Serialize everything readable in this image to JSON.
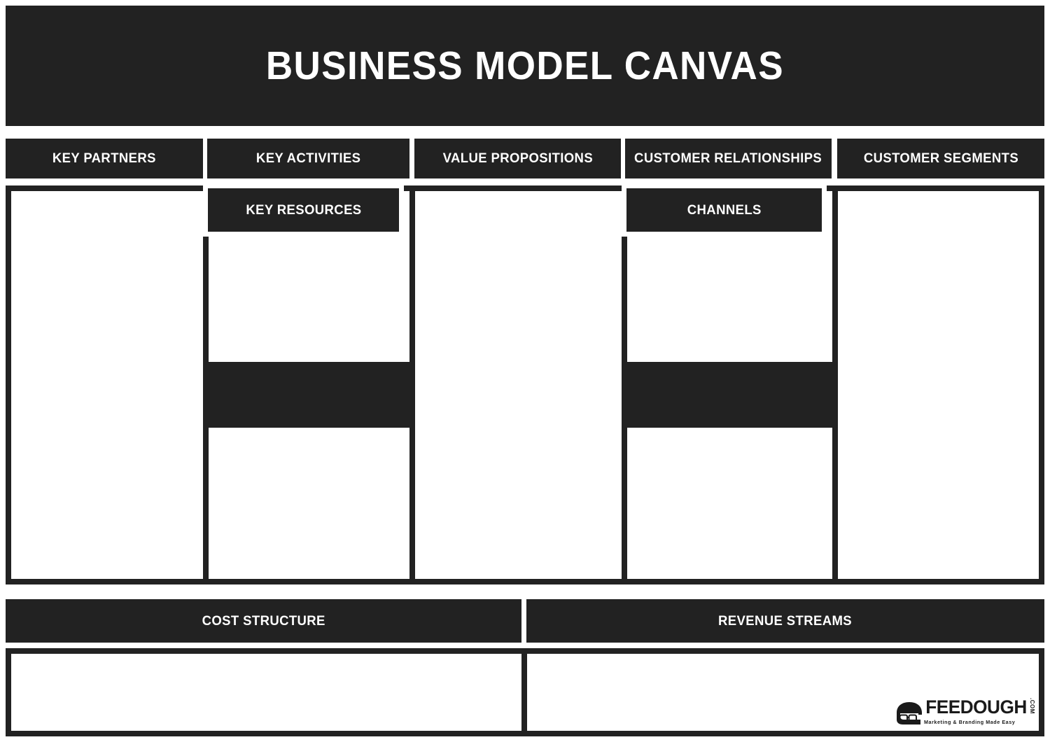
{
  "title": "BUSINESS MODEL CANVAS",
  "columns": [
    {
      "id": "key-partners",
      "label": "KEY PARTNERS"
    },
    {
      "id": "key-activities",
      "label": "KEY ACTIVITIES"
    },
    {
      "id": "value-propositions",
      "label": "VALUE PROPOSITIONS"
    },
    {
      "id": "customer-relationships",
      "label": "CUSTOMER RELATIONSHIPS"
    },
    {
      "id": "customer-segments",
      "label": "CUSTOMER SEGMENTS"
    }
  ],
  "sub_sections": [
    {
      "id": "key-resources",
      "label": "KEY RESOURCES"
    },
    {
      "id": "channels",
      "label": "CHANNELS"
    }
  ],
  "bottom_sections": [
    {
      "id": "cost-structure",
      "label": "COST STRUCTURE"
    },
    {
      "id": "revenue-streams",
      "label": "REVENUE STREAMS"
    }
  ],
  "cells": {
    "key_partners": "",
    "key_activities": "",
    "key_resources": "",
    "value_propositions": "",
    "customer_relationships": "",
    "channels": "",
    "customer_segments": "",
    "cost_structure": "",
    "revenue_streams": ""
  },
  "logo": {
    "name": "FEEDOUGH",
    "tld": ".COM",
    "tagline": "Marketing & Branding Made Easy"
  },
  "colors": {
    "ink": "#222222",
    "paper": "#ffffff",
    "logo_ink": "#1a1a1a"
  }
}
